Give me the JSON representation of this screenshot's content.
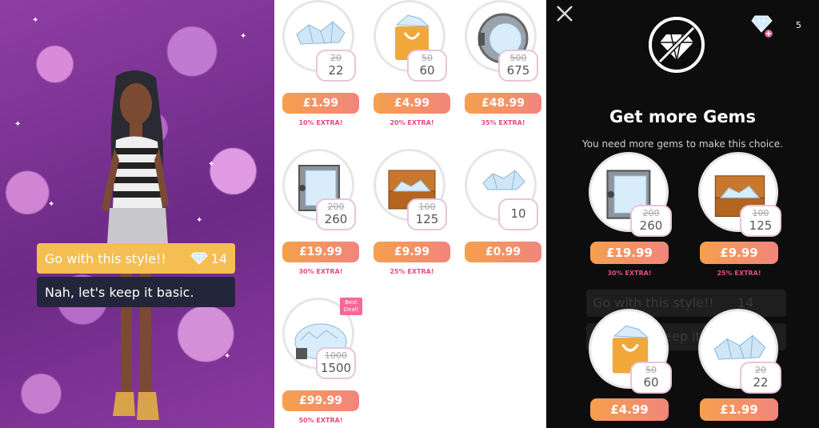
{
  "story": {
    "choices": [
      {
        "label": "Go with this style!!",
        "cost": "14"
      },
      {
        "label": "Nah, let's keep it basic."
      }
    ]
  },
  "store": {
    "packs": [
      {
        "old": "20",
        "new": "22",
        "price": "£1.99",
        "extra": "10% EXTRA!"
      },
      {
        "old": "50",
        "new": "60",
        "price": "£4.99",
        "extra": "20% EXTRA!"
      },
      {
        "old": "500",
        "new": "675",
        "price": "£48.99",
        "extra": "35% EXTRA!"
      },
      {
        "old": "200",
        "new": "260",
        "price": "£19.99",
        "extra": "30% EXTRA!"
      },
      {
        "old": "100",
        "new": "125",
        "price": "£9.99",
        "extra": "25% EXTRA!"
      },
      {
        "old": "",
        "new": "10",
        "price": "£0.99",
        "extra": ""
      },
      {
        "old": "1000",
        "new": "1500",
        "price": "£99.99",
        "extra": "50% EXTRA!",
        "badge": "Best Deal!"
      }
    ]
  },
  "modal": {
    "gem_count": "5",
    "title": "Get more Gems",
    "subtitle": "You need more gems to make this choice.",
    "ghost_choice": "Go with this style!!",
    "ghost_choice_cost": "14",
    "ghost_choice_2": "Nah, let's keep it basic.",
    "packs": [
      {
        "old": "200",
        "new": "260",
        "price": "£19.99",
        "extra": "30% EXTRA!"
      },
      {
        "old": "100",
        "new": "125",
        "price": "£9.99",
        "extra": "25% EXTRA!"
      },
      {
        "old": "50",
        "new": "60",
        "price": "£4.99",
        "extra": ""
      },
      {
        "old": "20",
        "new": "22",
        "price": "£1.99",
        "extra": ""
      }
    ]
  },
  "colors": {
    "accent_gold": "#f5be52",
    "price_gradient_start": "#f5a04d",
    "price_gradient_end": "#f2857d",
    "extra_pink": "#e54a85",
    "choice_dark": "#23263a"
  }
}
